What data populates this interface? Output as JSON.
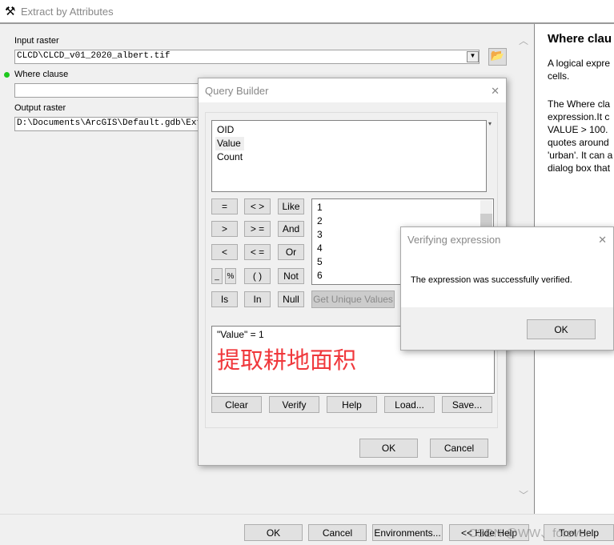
{
  "window": {
    "title": "Extract by Attributes"
  },
  "form": {
    "input_raster_label": "Input raster",
    "input_raster_value": "CLCD\\CLCD_v01_2020_albert.tif",
    "where_label": "Where clause",
    "where_value": "",
    "output_raster_label": "Output raster",
    "output_raster_value": "D:\\Documents\\ArcGIS\\Default.gdb\\Extrac"
  },
  "help": {
    "title": "Where clau",
    "p1": [
      "A logical expre",
      "cells."
    ],
    "p2": [
      "The Where cla",
      "expression.It c",
      "VALUE > 100.",
      "quotes around",
      "'urban'. It can a",
      "dialog box that"
    ]
  },
  "footer": {
    "ok": "OK",
    "cancel": "Cancel",
    "environments": "Environments...",
    "hide_help": "<< Hide Help",
    "tool_help": "Tool Help",
    "watermark": "CSDN @WW、forever"
  },
  "query_builder": {
    "title": "Query Builder",
    "fields": [
      "OID",
      "Value",
      "Count"
    ],
    "operators": [
      "=",
      "< >",
      "Like",
      "> ",
      "> =",
      "And",
      "<",
      "< =",
      "Or",
      "_",
      "%",
      "( )",
      "Not",
      "Is",
      "In",
      "Null"
    ],
    "values": [
      "1",
      "2",
      "3",
      "4",
      "5",
      "6"
    ],
    "get_unique": "Get Unique Values",
    "expression": "\"Value\" = 1",
    "annotation": "提取耕地面积",
    "annotation_color": "#f0383c",
    "buttons": [
      "Clear",
      "Verify",
      "Help",
      "Load...",
      "Save..."
    ],
    "ok": "OK",
    "cancel": "Cancel"
  },
  "verify": {
    "title": "Verifying expression",
    "message": "The expression was successfully verified.",
    "ok": "OK"
  }
}
